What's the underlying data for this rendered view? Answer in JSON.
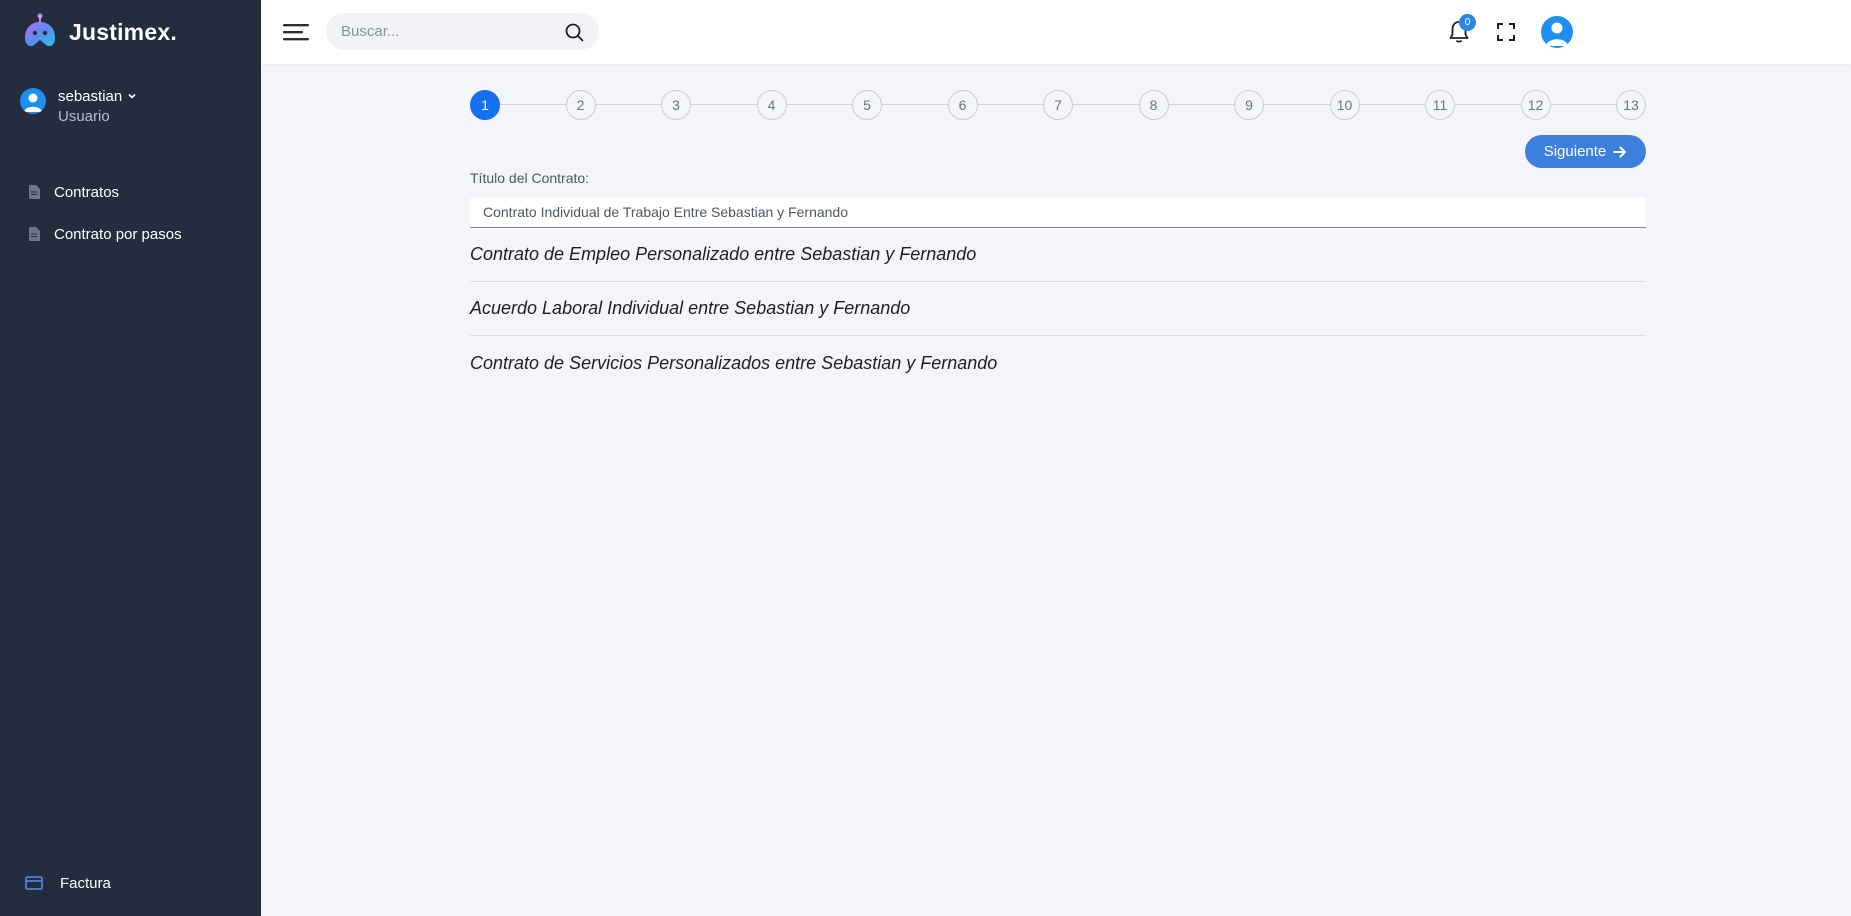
{
  "brand": {
    "name": "Justimex."
  },
  "user": {
    "name": "sebastian",
    "role": "Usuario"
  },
  "sidebar": {
    "items": [
      {
        "label": "Contratos"
      },
      {
        "label": "Contrato por pasos"
      }
    ],
    "footer": {
      "label": "Factura"
    }
  },
  "topbar": {
    "search_placeholder": "Buscar...",
    "notification_count": "0"
  },
  "stepper": {
    "steps": [
      "1",
      "2",
      "3",
      "4",
      "5",
      "6",
      "7",
      "8",
      "9",
      "10",
      "11",
      "12",
      "13"
    ],
    "active_step": 1
  },
  "form": {
    "next_label": "Siguiente",
    "title_label": "Título del Contrato:",
    "title_value": "Contrato Individual de Trabajo Entre Sebastian y Fernando",
    "suggestions": [
      "Contrato de Empleo Personalizado entre Sebastian y Fernando",
      "Acuerdo Laboral Individual entre Sebastian y Fernando",
      "Contrato de Servicios Personalizados entre Sebastian y Fernando"
    ]
  },
  "colors": {
    "sidebar_bg": "#232d3d",
    "accent": "#1570ef",
    "button": "#3d7fdc"
  }
}
